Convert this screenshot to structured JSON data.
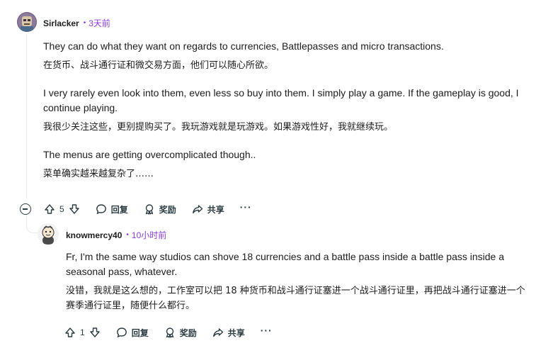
{
  "comment": {
    "author": "Sirlacker",
    "time": "3天前",
    "paragraphs": [
      "They can do what they want on regards to currencies, Battlepasses and micro transactions.",
      "在货币、战斗通行证和微交易方面，他们可以随心所欲。",
      "I very rarely even look into them, even less so buy into them. I simply play a game. If the gameplay is good, I continue playing.",
      "我很少关注这些，更别提购买了。我玩游戏就是玩游戏。如果游戏性好，我就继续玩。",
      "The menus are getting overcomplicated though..",
      "菜单确实越来越复杂了……"
    ],
    "votes": "5",
    "reply_label": "回复",
    "award_label": "奖励",
    "share_label": "共享",
    "more_label": "···"
  },
  "reply": {
    "author": "knowmercy40",
    "time": "10小时前",
    "paragraphs": [
      "Fr, I'm the same way studios can shove 18 currencies and a battle pass inside a battle pass inside a seasonal pass, whatever.",
      "没错，我就是这么想的，工作室可以把 18 种货币和战斗通行证塞进一个战斗通行证里，再把战斗通行证塞进一个赛季通行证里，随便什么都行。"
    ],
    "votes": "1",
    "reply_label": "回复",
    "award_label": "奖励",
    "share_label": "共享",
    "more_label": "···"
  },
  "colors": {
    "accent": "#8a3bd8",
    "text": "#1c1c1c",
    "icon": "#2a3c42",
    "thread": "#e5ebee"
  }
}
